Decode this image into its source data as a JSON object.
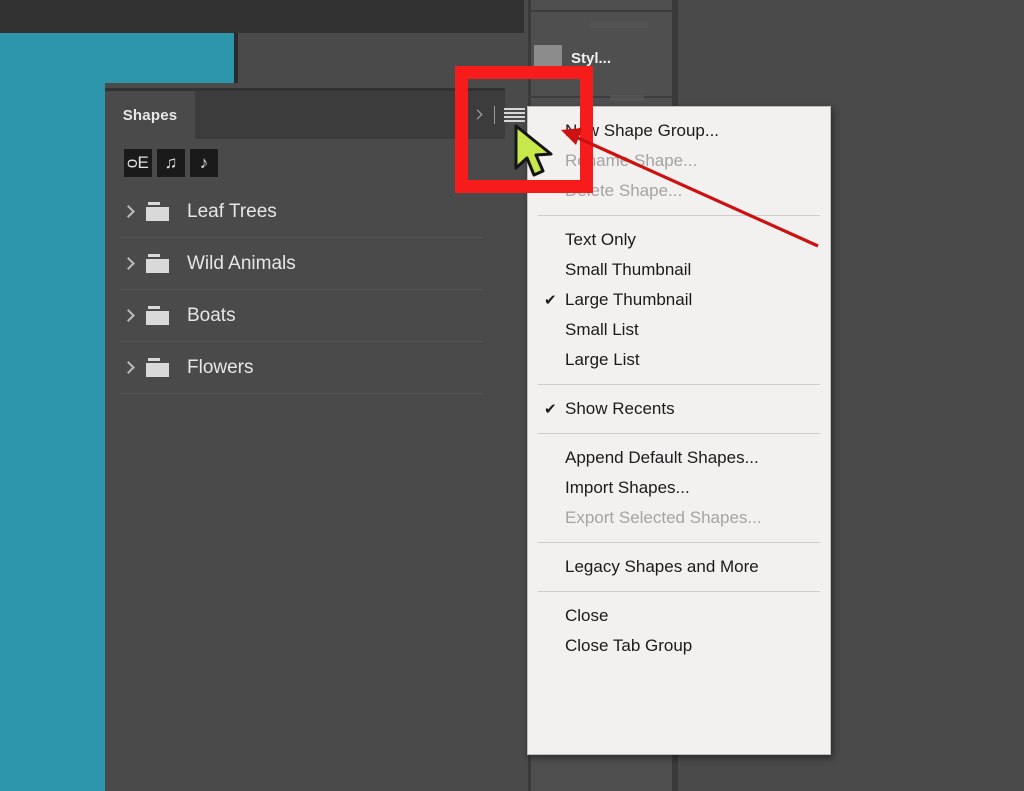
{
  "app": {
    "background_color": "#4a4a4a",
    "canvas_color": "#2d96ad"
  },
  "shapes_panel": {
    "tab_label": "Shapes",
    "controls": {
      "expand_icon": "chevron-right-icon",
      "menu_icon": "hamburger-menu-icon"
    },
    "recents": [
      {
        "name": "recent-shape-clef",
        "glyph": "ᴑE"
      },
      {
        "name": "recent-shape-beamed-notes",
        "glyph": "♫"
      },
      {
        "name": "recent-shape-eighth-note",
        "glyph": "♪"
      }
    ],
    "folders": [
      {
        "label": "Leaf Trees"
      },
      {
        "label": "Wild Animals"
      },
      {
        "label": "Boats"
      },
      {
        "label": "Flowers"
      }
    ]
  },
  "dock": {
    "styles_item_label": "Styl..."
  },
  "context_menu": {
    "groups": [
      {
        "items": [
          {
            "label": "New Shape Group...",
            "checked": false,
            "disabled": false
          },
          {
            "label": "Rename Shape...",
            "checked": false,
            "disabled": true
          },
          {
            "label": "Delete Shape...",
            "checked": false,
            "disabled": true
          }
        ]
      },
      {
        "items": [
          {
            "label": "Text Only",
            "checked": false,
            "disabled": false
          },
          {
            "label": "Small Thumbnail",
            "checked": false,
            "disabled": false
          },
          {
            "label": "Large Thumbnail",
            "checked": true,
            "disabled": false
          },
          {
            "label": "Small List",
            "checked": false,
            "disabled": false
          },
          {
            "label": "Large List",
            "checked": false,
            "disabled": false
          }
        ]
      },
      {
        "items": [
          {
            "label": "Show Recents",
            "checked": true,
            "disabled": false
          }
        ]
      },
      {
        "items": [
          {
            "label": "Append Default Shapes...",
            "checked": false,
            "disabled": false
          },
          {
            "label": "Import Shapes...",
            "checked": false,
            "disabled": false
          },
          {
            "label": "Export Selected Shapes...",
            "checked": false,
            "disabled": true
          }
        ]
      },
      {
        "items": [
          {
            "label": "Legacy Shapes and More",
            "checked": false,
            "disabled": false
          }
        ]
      },
      {
        "items": [
          {
            "label": "Close",
            "checked": false,
            "disabled": false
          },
          {
            "label": "Close Tab Group",
            "checked": false,
            "disabled": false
          }
        ]
      }
    ],
    "checkmark_glyph": "✔"
  },
  "annotations": {
    "highlight_color": "#f71c1c",
    "arrow_color": "#cc1111",
    "cursor_color": "#c6e84a"
  }
}
